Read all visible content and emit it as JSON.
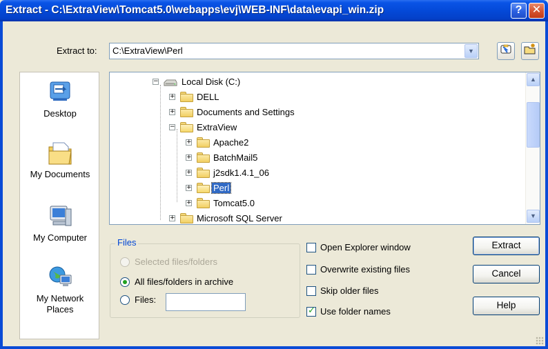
{
  "window": {
    "title": "Extract - C:\\ExtraView\\Tomcat5.0\\webapps\\evj\\WEB-INF\\data\\evapi_win.zip",
    "help_button": "?",
    "close_button": "✕"
  },
  "extract_to": {
    "label": "Extract to:",
    "value": "C:\\ExtraView\\Perl"
  },
  "places": [
    {
      "label": "Desktop",
      "icon": "desktop-icon"
    },
    {
      "label": "My Documents",
      "icon": "my-documents-icon"
    },
    {
      "label": "My Computer",
      "icon": "my-computer-icon"
    },
    {
      "label": "My Network Places",
      "icon": "network-places-icon"
    }
  ],
  "tree": {
    "items": [
      {
        "label": "Local Disk (C:)",
        "expander": "−",
        "icon": "drive-icon"
      },
      {
        "label": "DELL",
        "expander": "+",
        "icon": "folder-icon"
      },
      {
        "label": "Documents and Settings",
        "expander": "+",
        "icon": "folder-icon"
      },
      {
        "label": "ExtraView",
        "expander": "−",
        "icon": "folder-open-icon"
      },
      {
        "label": "Apache2",
        "expander": "+",
        "icon": "folder-icon"
      },
      {
        "label": "BatchMail5",
        "expander": "+",
        "icon": "folder-icon"
      },
      {
        "label": "j2sdk1.4.1_06",
        "expander": "+",
        "icon": "folder-icon"
      },
      {
        "label": "Perl",
        "expander": "+",
        "icon": "folder-open-icon",
        "selected": true
      },
      {
        "label": "Tomcat5.0",
        "expander": "+",
        "icon": "folder-icon"
      },
      {
        "label": "Microsoft SQL Server",
        "expander": "+",
        "icon": "folder-icon"
      }
    ]
  },
  "files_group": {
    "title": "Files",
    "options": [
      {
        "label": "Selected files/folders",
        "enabled": false,
        "checked": false
      },
      {
        "label": "All files/folders in archive",
        "enabled": true,
        "checked": true
      },
      {
        "label": "Files:",
        "enabled": true,
        "checked": false
      }
    ],
    "files_input_value": ""
  },
  "checkboxes": [
    {
      "label": "Open Explorer window",
      "checked": false
    },
    {
      "label": "Overwrite existing files",
      "checked": false
    },
    {
      "label": "Skip older files",
      "checked": false
    },
    {
      "label": "Use folder names",
      "checked": true
    }
  ],
  "buttons": {
    "extract": "Extract",
    "cancel": "Cancel",
    "help": "Help"
  },
  "colors": {
    "titlebar": "#0449d8",
    "selection": "#316ac5",
    "dialog_bg": "#ECE9D8",
    "group_title": "#0046d5"
  }
}
